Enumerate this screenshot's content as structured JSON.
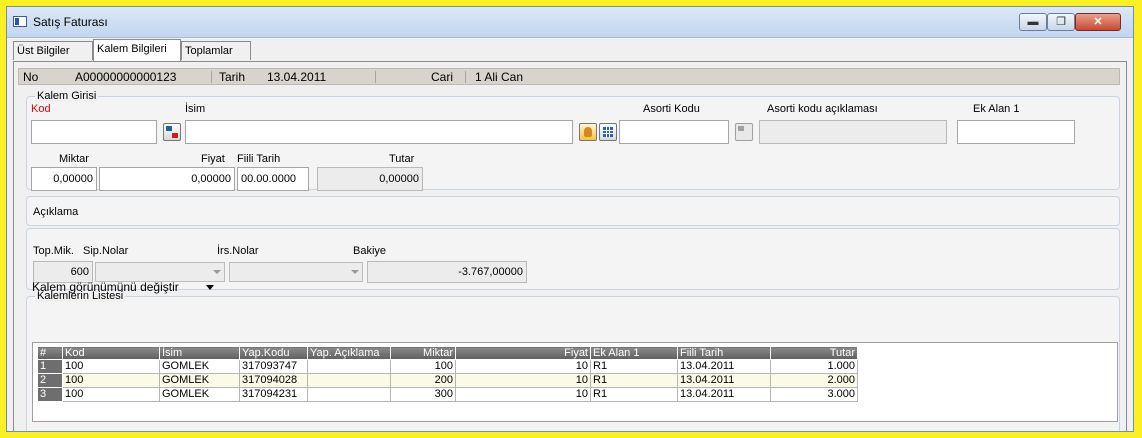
{
  "window": {
    "title": "Satış Faturası",
    "min_glyph": "▬",
    "max_glyph": "❐",
    "close_glyph": "✕"
  },
  "tabs": [
    {
      "label": "Üst Bilgiler"
    },
    {
      "label": "Kalem Bilgileri"
    },
    {
      "label": "Toplamlar"
    }
  ],
  "header": {
    "no_label": "No",
    "no_value": "A00000000000123",
    "tarih_label": "Tarih",
    "tarih_value": "13.04.2011",
    "cari_label": "Cari",
    "cari_value": "1 Ali Can"
  },
  "kalem_girisi": {
    "title": "Kalem Girisi",
    "kod_label": "Kod",
    "kod_value": "",
    "isim_label": "İsim",
    "isim_value": "",
    "asorti_label": "Asorti Kodu",
    "asorti_value": "",
    "asorti_aciklama_label": "Asorti kodu açıklaması",
    "asorti_aciklama_value": "",
    "ek_alan_label": "Ek Alan 1",
    "ek_alan_value": "",
    "miktar_label": "Miktar",
    "miktar_value": "0,00000",
    "fiyat_label": "Fiyat",
    "fiyat_value": "0,00000",
    "fiili_tarih_label": "Fiili Tarih",
    "fiili_tarih_value": "00.00.0000",
    "tutar_label": "Tutar",
    "tutar_value": "0,00000"
  },
  "aciklama": {
    "label": "Açıklama"
  },
  "totals": {
    "top_mik_label": "Top.Mik.",
    "top_mik_value": "600",
    "sip_label": "Sip.Nolar",
    "irs_label": "İrs.Nolar",
    "bakiye_label": "Bakiye",
    "bakiye_value": "-3.767,00000"
  },
  "kalemlerin_listesi": {
    "title": "Kalemlerin Listesi",
    "view_toggle": "Kalem görünümünü değiştir",
    "columns": [
      "#",
      "Kod",
      "İsim",
      "Yap.Kodu",
      "Yap. Açıklama",
      "Miktar",
      "Fiyat",
      "Ek Alan 1",
      "Fiili Tarih",
      "Tutar"
    ],
    "rows": [
      [
        "1",
        "100",
        "GOMLEK",
        "317093747",
        "",
        "100",
        "10",
        "R1",
        "13.04.2011",
        "1.000"
      ],
      [
        "2",
        "100",
        "GOMLEK",
        "317094028",
        "",
        "200",
        "10",
        "R1",
        "13.04.2011",
        "2.000"
      ],
      [
        "3",
        "100",
        "GOMLEK",
        "317094231",
        "",
        "300",
        "10",
        "R1",
        "13.04.2011",
        "3.000"
      ]
    ]
  }
}
